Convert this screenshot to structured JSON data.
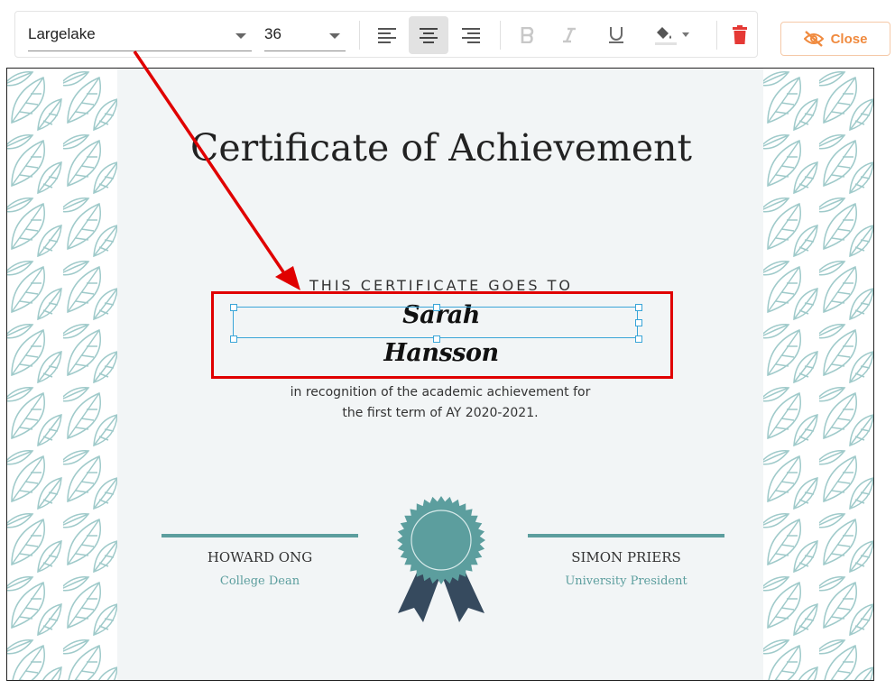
{
  "toolbar": {
    "font_family_value": "Largelake",
    "font_size_value": "36"
  },
  "close_button": {
    "label": "Close"
  },
  "certificate": {
    "title": "Certificate of Achievement",
    "goes_to": "THIS CERTIFICATE GOES TO",
    "recipient_first": "Sarah",
    "recipient_last": "Hansson",
    "recognition_line1": "in recognition of the academic achievement for",
    "recognition_line2": "the first term of AY 2020-2021.",
    "signatories": [
      {
        "name": "HOWARD ONG",
        "role": "College Dean"
      },
      {
        "name": "SIMON PRIERS",
        "role": "University President"
      }
    ]
  },
  "colors": {
    "accent_teal": "#5c9e9e",
    "ribbon_navy": "#364a5e",
    "selection_blue": "#3aa5d8",
    "annotation_red": "#e00000",
    "close_orange": "#f08a3e",
    "delete_red": "#e53935"
  },
  "icons": [
    "chevron-down-icon",
    "align-left-icon",
    "align-center-icon",
    "align-right-icon",
    "bold-icon",
    "italic-icon",
    "underline-icon",
    "fill-color-icon",
    "trash-icon",
    "eye-off-icon"
  ]
}
